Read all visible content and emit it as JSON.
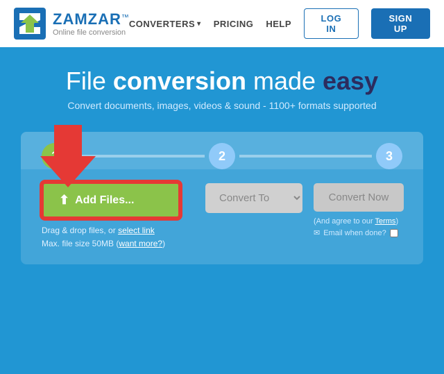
{
  "header": {
    "logo_name": "ZAMZAR",
    "logo_tm": "™",
    "logo_tagline": "Online file conversion",
    "nav": {
      "converters_label": "CONVERTERS",
      "pricing_label": "PRICING",
      "help_label": "HELP",
      "login_label": "LOG IN",
      "signup_label": "SIGN UP"
    }
  },
  "hero": {
    "title_part1": "File ",
    "title_part2": "conversion",
    "title_part3": " made ",
    "title_part4": "easy",
    "subtitle": "Convert documents, images, videos & sound - 1100+ formats supported"
  },
  "steps": {
    "step1_label": "1",
    "step2_label": "2",
    "step3_label": "3"
  },
  "converter": {
    "add_files_label": "Add Files...",
    "drag_text": "Drag & drop files, or",
    "select_link_text": "select link",
    "max_size_text": "Max. file size 50MB (",
    "want_more_text": "want more?",
    "want_more_end": ")",
    "convert_to_label": "Convert To",
    "convert_now_label": "Convert Now",
    "terms_text": "(And agree to our",
    "terms_link": "Terms",
    "terms_end": ")",
    "email_label": "Email when done?",
    "convert_to_placeholder": "Convert To"
  }
}
